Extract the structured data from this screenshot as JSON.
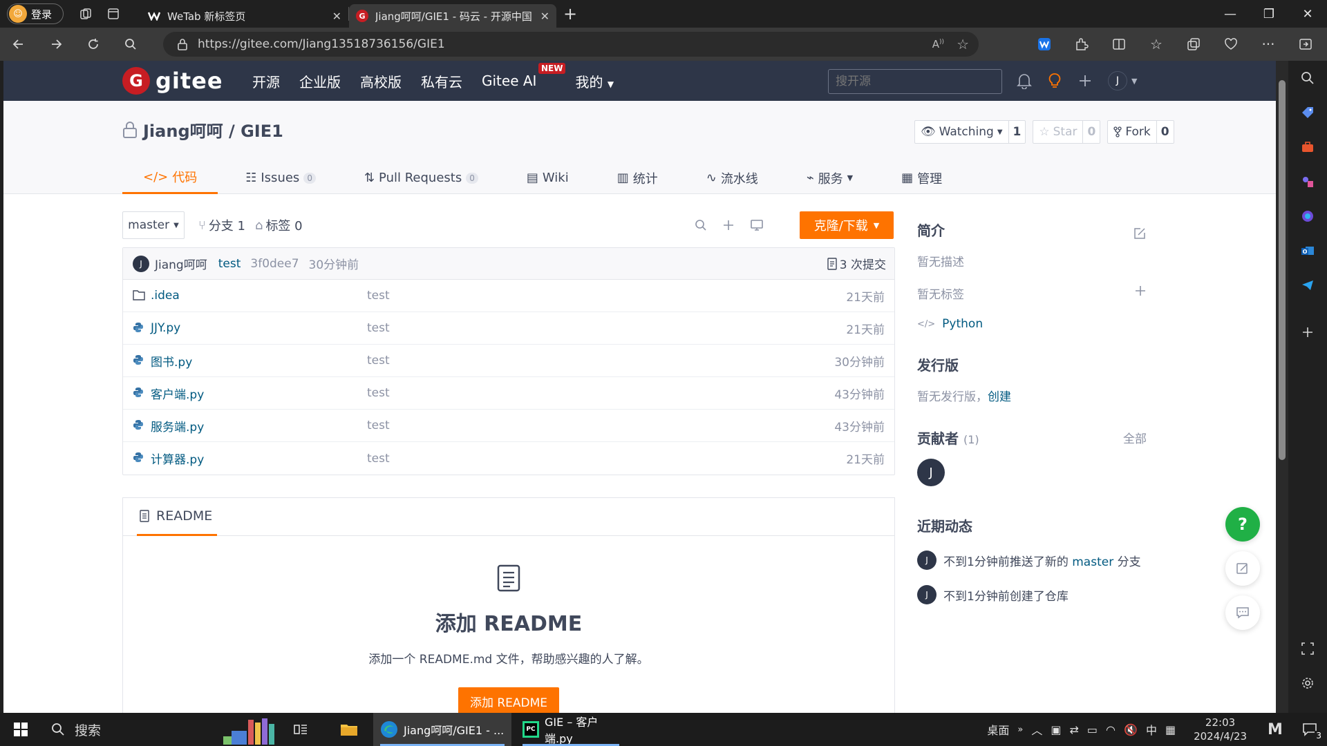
{
  "browser": {
    "profile_label": "登录",
    "tabs": [
      {
        "title": "WeTab 新标签页",
        "active": false
      },
      {
        "title": "Jiang呵呵/GIE1 - 码云 - 开源中国",
        "active": true
      }
    ],
    "url": "https://gitee.com/Jiang13518736156/GIE1"
  },
  "gitee": {
    "logo_text": "gitee",
    "nav": [
      "开源",
      "企业版",
      "高校版",
      "私有云"
    ],
    "nav_ai": "Gitee AI",
    "new_badge": "NEW",
    "nav_mine": "我的",
    "search_placeholder": "搜开源",
    "user_initial": "J"
  },
  "repo": {
    "title": "Jiang呵呵 / GIE1",
    "watch_label": "Watching",
    "watch_count": "1",
    "star_label": "Star",
    "star_count": "0",
    "fork_label": "Fork",
    "fork_count": "0",
    "tabs": [
      {
        "label": "代码",
        "icon": "code-icon",
        "count": null,
        "active": true
      },
      {
        "label": "Issues",
        "icon": "issues-icon",
        "count": "0",
        "active": false
      },
      {
        "label": "Pull Requests",
        "icon": "pull-request-icon",
        "count": "0",
        "active": false
      },
      {
        "label": "Wiki",
        "icon": "wiki-icon",
        "count": null,
        "active": false
      },
      {
        "label": "统计",
        "icon": "stats-icon",
        "count": null,
        "active": false
      },
      {
        "label": "流水线",
        "icon": "pipeline-icon",
        "count": null,
        "active": false
      },
      {
        "label": "服务",
        "icon": "service-icon",
        "count": null,
        "active": false
      },
      {
        "label": "管理",
        "icon": "manage-icon",
        "count": null,
        "active": false
      }
    ]
  },
  "tree": {
    "branch": "master",
    "branches_label": "分支 1",
    "tags_label": "标签 0",
    "clone_label": "克隆/下载"
  },
  "commit": {
    "author_initial": "J",
    "author": "Jiang呵呵",
    "message": "test",
    "hash": "3f0dee7",
    "time": "30分钟前",
    "count_label": "3 次提交"
  },
  "files": [
    {
      "name": ".idea",
      "type": "folder",
      "message": "test",
      "time": "21天前"
    },
    {
      "name": "JJY.py",
      "type": "python",
      "message": "test",
      "time": "21天前"
    },
    {
      "name": "图书.py",
      "type": "python",
      "message": "test",
      "time": "30分钟前"
    },
    {
      "name": "客户端.py",
      "type": "python",
      "message": "test",
      "time": "43分钟前"
    },
    {
      "name": "服务端.py",
      "type": "python",
      "message": "test",
      "time": "43分钟前"
    },
    {
      "name": "计算器.py",
      "type": "python",
      "message": "test",
      "time": "21天前"
    }
  ],
  "readme": {
    "tab_label": "README",
    "title": "添加 README",
    "description": "添加一个 README.md 文件，帮助感兴趣的人了解。",
    "button_label": "添加 README"
  },
  "sidebar": {
    "intro_title": "简介",
    "no_description": "暂无描述",
    "no_tags": "暂无标签",
    "language": "Python",
    "releases_title": "发行版",
    "no_releases": "暂无发行版，",
    "create_label": "创建",
    "contributors_title": "贡献者",
    "contributors_count": "(1)",
    "all_label": "全部",
    "contributor_initial": "J",
    "activity_title": "近期动态",
    "activities": [
      {
        "initial": "J",
        "text": "不到1分钟前推送了新的 ",
        "branch": "master",
        "suffix": " 分支"
      },
      {
        "initial": "J",
        "text": "不到1分钟前创建了仓库",
        "branch": "",
        "suffix": ""
      }
    ]
  },
  "floating": {
    "help_label": "?"
  },
  "taskbar": {
    "search_label": "搜索",
    "apps": [
      {
        "title": "Jiang呵呵/GIE1 - ...",
        "icon": "edge-icon",
        "active": true
      },
      {
        "title": "GIE – 客户端.py",
        "icon": "pycharm-icon",
        "active": false
      }
    ],
    "desktop_label": "桌面",
    "ime_label": "中",
    "time": "22:03",
    "date": "2024/4/23",
    "notification_count": "3"
  },
  "colors": {
    "accent": "#fe7300",
    "header_bg": "#2e3648",
    "link": "#005980",
    "brand_red": "#c71d23",
    "help_green": "#20b046"
  }
}
